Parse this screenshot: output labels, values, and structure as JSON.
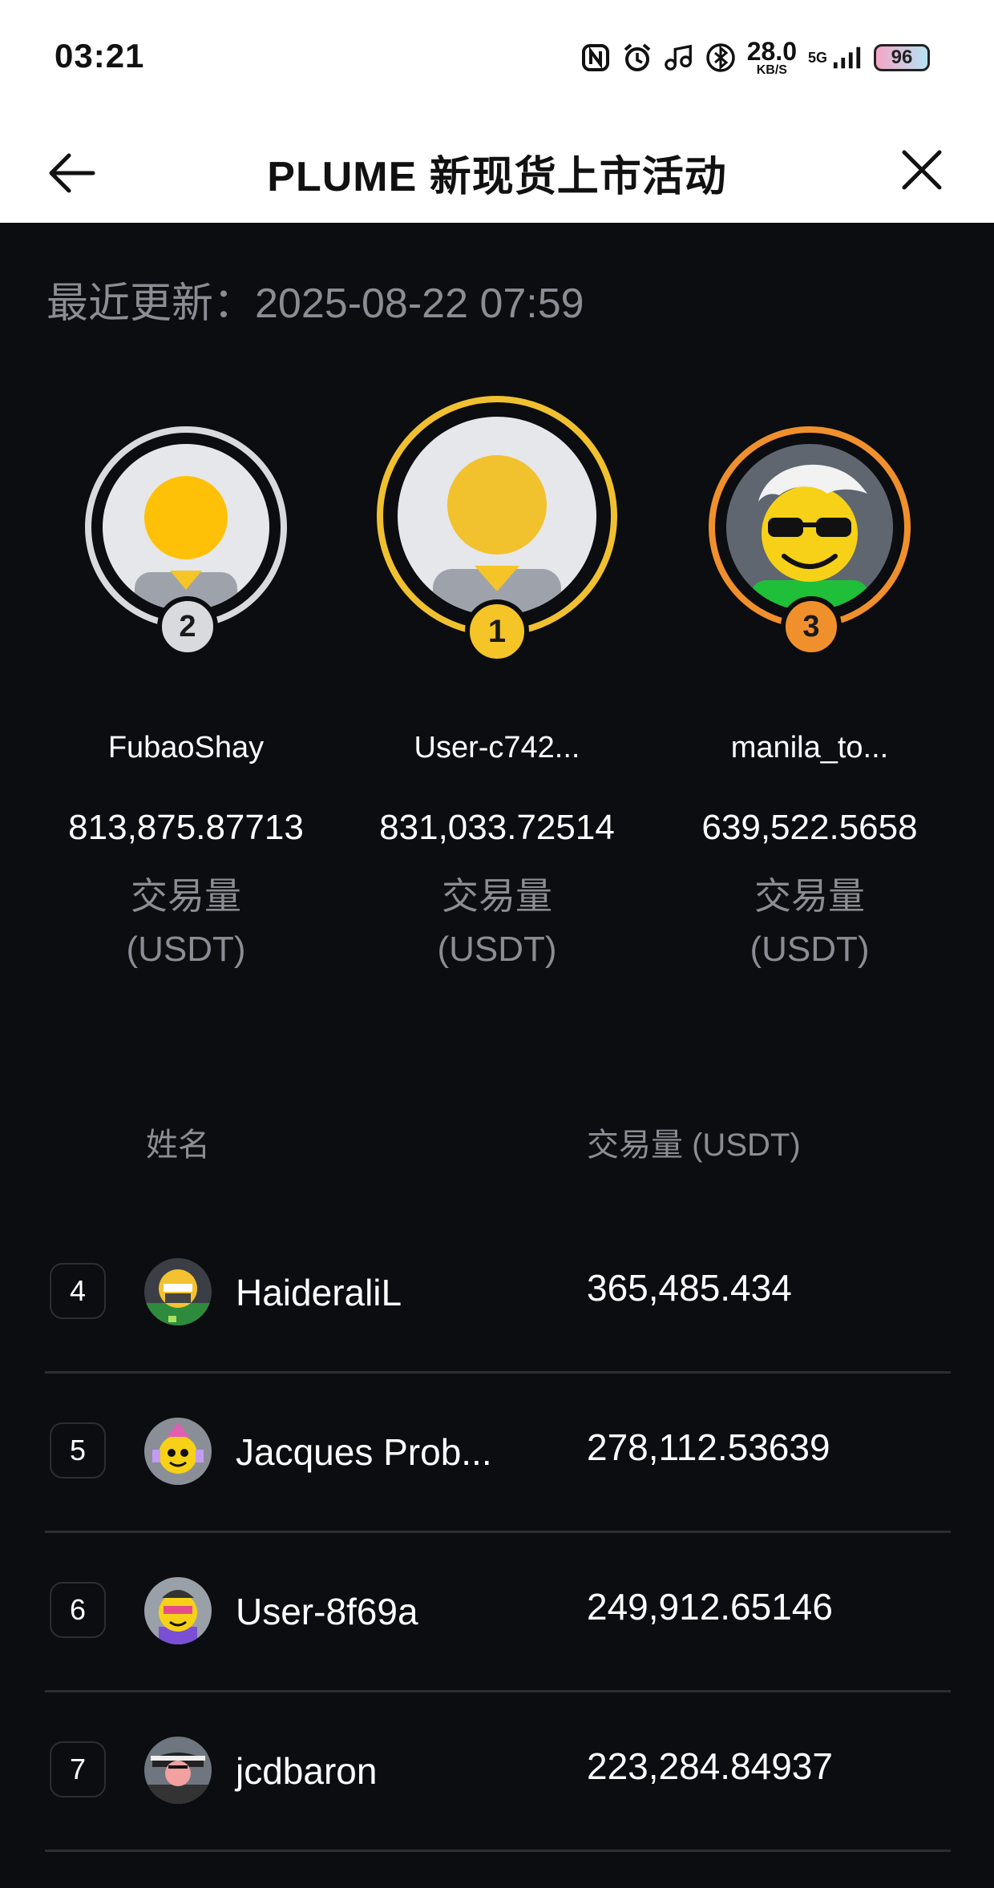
{
  "status": {
    "time": "03:21",
    "net_speed": "28.0",
    "net_unit": "KB/S",
    "network": "5G",
    "battery": "96",
    "icons": [
      "nfc-icon",
      "alarm-icon",
      "music-icon",
      "bluetooth-icon",
      "signal-icon"
    ]
  },
  "header": {
    "title": "PLUME 新现货上市活动",
    "back_icon": "arrow-left-icon",
    "close_icon": "close-icon"
  },
  "leaderboard": {
    "updated_label": "最近更新：",
    "updated_time": "2025-08-22 07:59",
    "podium": [
      {
        "rank": "2",
        "name": "FubaoShay",
        "value": "813,875.87713",
        "label": "交易量",
        "unit": "(USDT)",
        "ring_color": "#d9dadd",
        "badge_color": "#d9dadd"
      },
      {
        "rank": "1",
        "name": "User-c742...",
        "value": "831,033.72514",
        "label": "交易量",
        "unit": "(USDT)",
        "ring_color": "#f0c030",
        "badge_color": "#f5c427"
      },
      {
        "rank": "3",
        "name": "manila_to...",
        "value": "639,522.5658",
        "label": "交易量",
        "unit": "(USDT)",
        "ring_color": "#f0902c",
        "badge_color": "#f0902c"
      }
    ],
    "columns": {
      "name": "姓名",
      "volume": "交易量 (USDT)"
    },
    "rows": [
      {
        "rank": "4",
        "name": "HaideraliL",
        "value": "365,485.434"
      },
      {
        "rank": "5",
        "name": "Jacques Prob...",
        "value": "278,112.53639"
      },
      {
        "rank": "6",
        "name": "User-8f69a",
        "value": "249,912.65146"
      },
      {
        "rank": "7",
        "name": "jcdbaron",
        "value": "223,284.84937"
      }
    ]
  }
}
